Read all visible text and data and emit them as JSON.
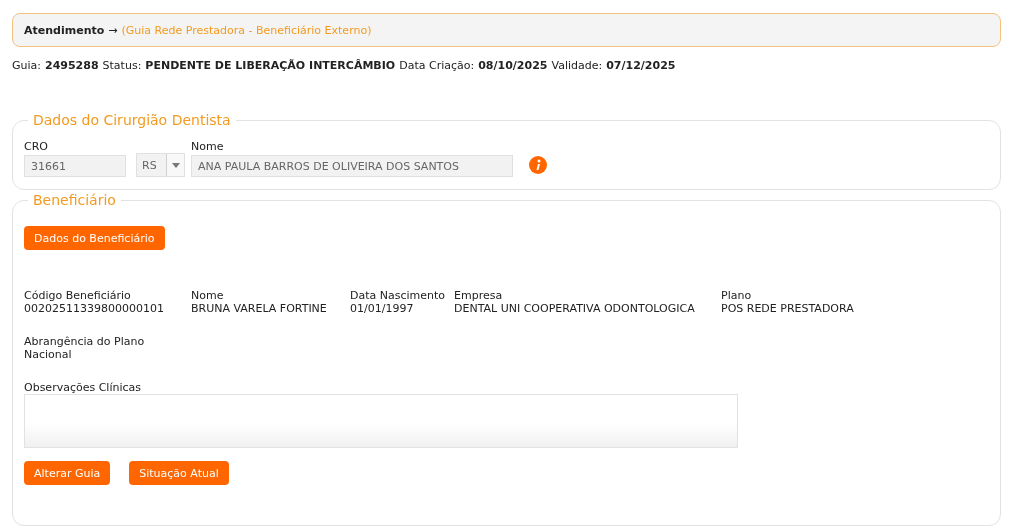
{
  "breadcrumb": {
    "root": "Atendimento",
    "separator": "→",
    "current": "(Guia Rede Prestadora - Beneficiário Externo)"
  },
  "info": [
    {
      "label": "Guia:",
      "value": "2495288"
    },
    {
      "label": "Status:",
      "value": "PENDENTE DE LIBERAÇÃO INTERCÂMBIO"
    },
    {
      "label": "Data Criação:",
      "value": "08/10/2025"
    },
    {
      "label": "Validade:",
      "value": "07/12/2025"
    }
  ],
  "dentist": {
    "legend": "Dados do Cirurgião Dentista",
    "cro_label": "CRO",
    "cro": "31661",
    "uf": "RS",
    "name_label": "Nome",
    "name": "ANA PAULA BARROS DE OLIVEIRA DOS SANTOS"
  },
  "beneficiary": {
    "legend": "Beneficiário",
    "details_button": "Dados do Beneficiário",
    "fields": [
      {
        "label": "Código Beneficiário",
        "value": "00202511339800000101"
      },
      {
        "label": "Nome",
        "value": "BRUNA VARELA FORTINE"
      },
      {
        "label": "Data Nascimento",
        "value": "01/01/1997"
      },
      {
        "label": "Empresa",
        "value": "DENTAL UNI COOPERATIVA ODONTOLOGICA"
      },
      {
        "label": "Plano",
        "value": "POS REDE PRESTADORA"
      }
    ],
    "coverage": {
      "label": "Abrangência do Plano",
      "value": "Nacional"
    },
    "notes_label": "Observações Clínicas",
    "buttons": [
      "Alterar Guia",
      "Situação Atual"
    ]
  }
}
